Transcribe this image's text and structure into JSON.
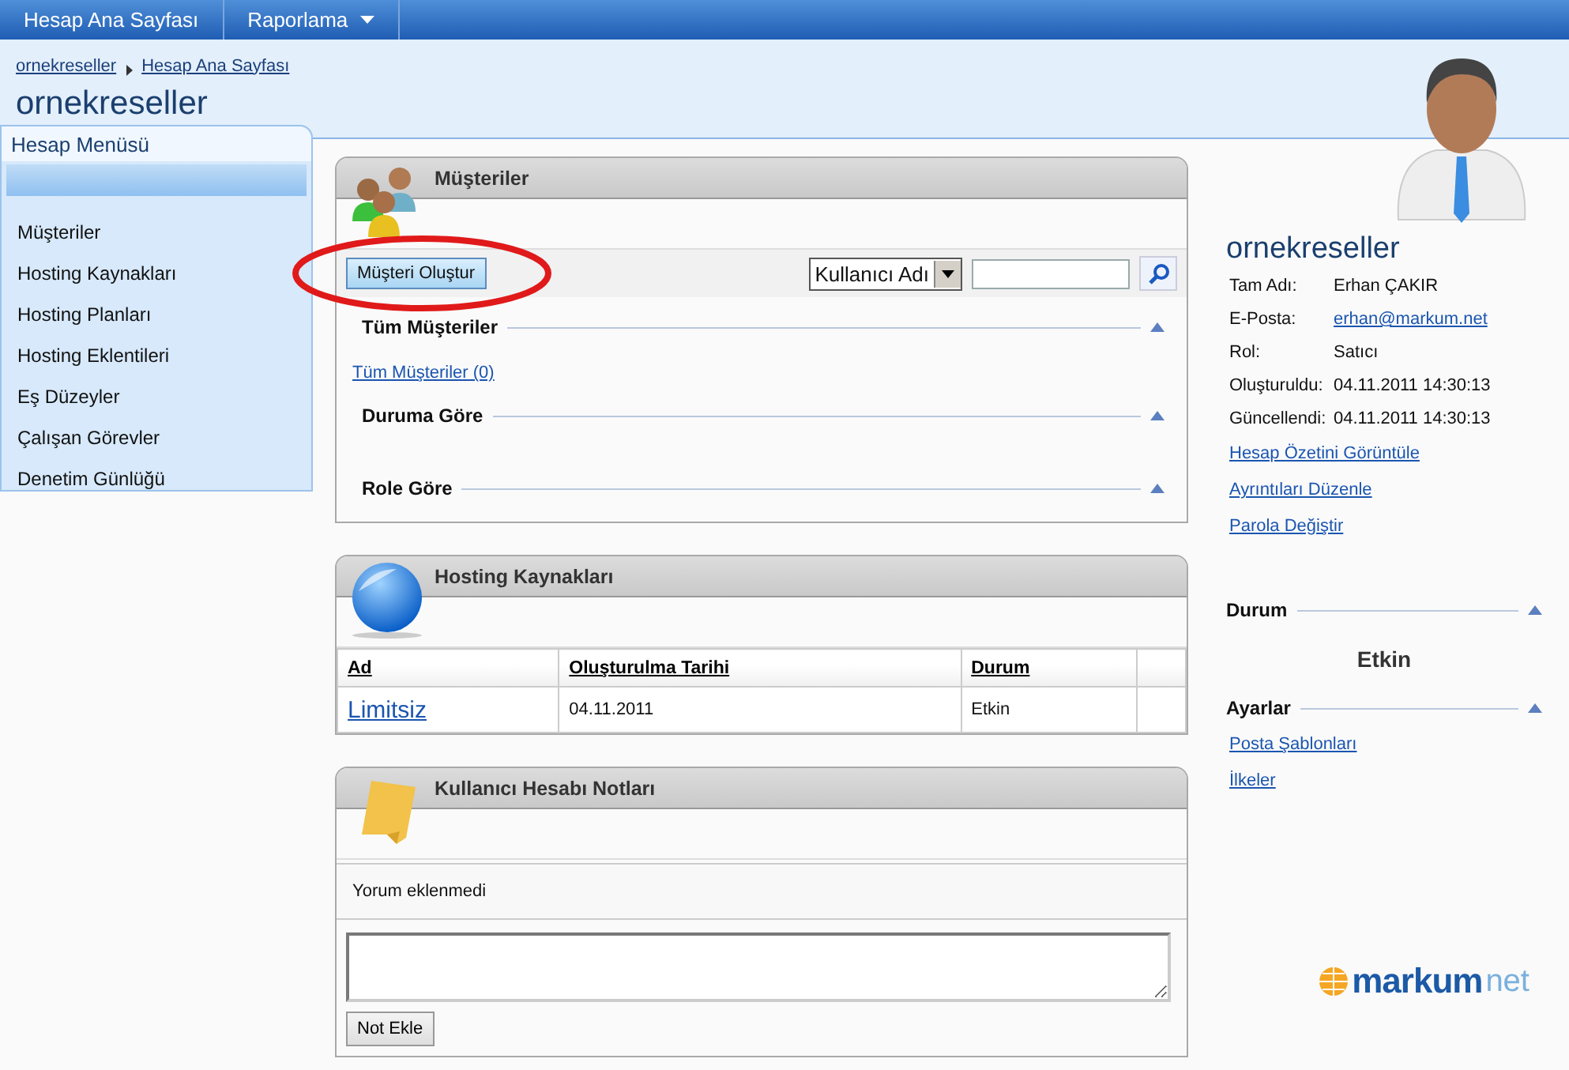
{
  "nav": [
    {
      "label": "Hesap Ana Sayfası",
      "dropdown": false
    },
    {
      "label": "Raporlama",
      "dropdown": true
    }
  ],
  "breadcrumb": [
    "ornekreseller",
    "Hesap Ana Sayfası"
  ],
  "page_title": "ornekreseller",
  "sidebar": {
    "title": "Hesap Menüsü",
    "items": [
      "Müşteriler",
      "Hosting Kaynakları",
      "Hosting Planları",
      "Hosting Eklentileri",
      "Eş Düzeyler",
      "Çalışan Görevler",
      "Denetim Günlüğü"
    ]
  },
  "customers": {
    "title": "Müşteriler",
    "create_button": "Müşteri Oluştur",
    "filter": {
      "value": "Kullanıcı Adı"
    },
    "sections": [
      {
        "title": "Tüm Müşteriler",
        "expanded": true,
        "links": [
          "Tüm Müşteriler (0)"
        ]
      },
      {
        "title": "Duruma Göre",
        "expanded": true
      },
      {
        "title": "Role Göre",
        "expanded": true
      }
    ]
  },
  "hosting": {
    "title": "Hosting Kaynakları",
    "columns": [
      "Ad",
      "Oluşturulma Tarihi",
      "Durum"
    ],
    "rows": [
      [
        "Limitsiz",
        "04.11.2011",
        "Etkin"
      ]
    ]
  },
  "notes": {
    "title": "Kullanıcı Hesabı Notları",
    "empty_text": "Yorum eklenmedi",
    "add_button": "Not Ekle"
  },
  "profile": {
    "name": "ornekreseller",
    "fields": [
      {
        "label": "Tam Adı:",
        "value": "Erhan ÇAKIR",
        "kind": "text"
      },
      {
        "label": "E-Posta:",
        "value": "erhan@markum.net",
        "kind": "link"
      },
      {
        "label": "Rol:",
        "value": "Satıcı",
        "kind": "text"
      },
      {
        "label": "Oluşturuldu:",
        "value": "04.11.2011 14:30:13",
        "kind": "text"
      },
      {
        "label": "Güncellendi:",
        "value": "04.11.2011 14:30:13",
        "kind": "text"
      }
    ],
    "links": [
      "Hesap Özetini Görüntüle",
      "Ayrıntıları Düzenle",
      "Parola Değiştir"
    ]
  },
  "status": {
    "title": "Durum",
    "expanded": true,
    "value": "Etkin"
  },
  "settings": {
    "title": "Ayarlar",
    "expanded": true,
    "links": [
      "Posta Şablonları",
      "İlkeler"
    ]
  },
  "logo": {
    "name": "markum",
    "suffix": "net"
  }
}
